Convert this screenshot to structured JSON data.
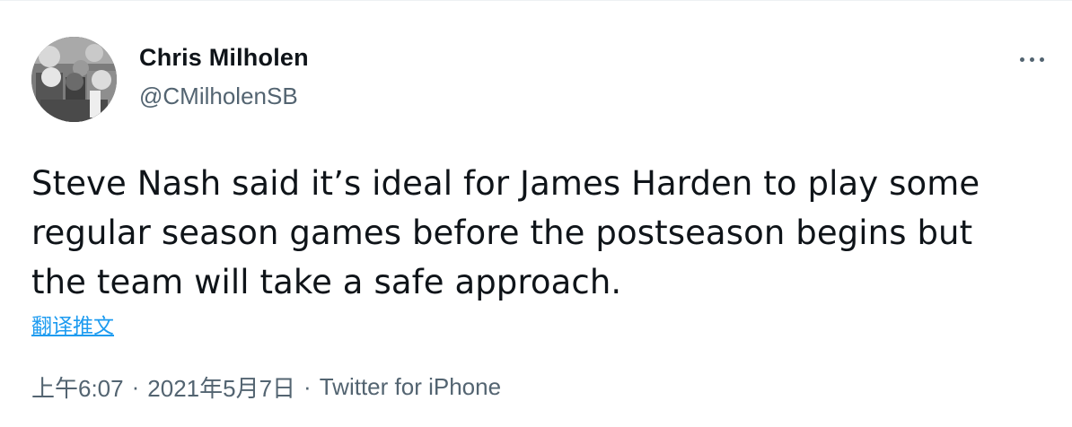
{
  "tweet": {
    "author": {
      "display_name": "Chris Milholen",
      "handle": "@CMilholenSB",
      "avatar_icon": "user-avatar-photo"
    },
    "more_icon": "more-options-icon",
    "text": "Steve Nash said it’s ideal for James Harden to play some regular season games before the postseason begins but the team will take a safe approach.",
    "translate_label": "翻译推文",
    "time": "上午6:07",
    "separator": "·",
    "date": "2021年5月7日",
    "source": "Twitter for iPhone"
  },
  "colors": {
    "text": "#0f1419",
    "secondary": "#536471",
    "link": "#1d9bf0",
    "background": "#ffffff"
  }
}
